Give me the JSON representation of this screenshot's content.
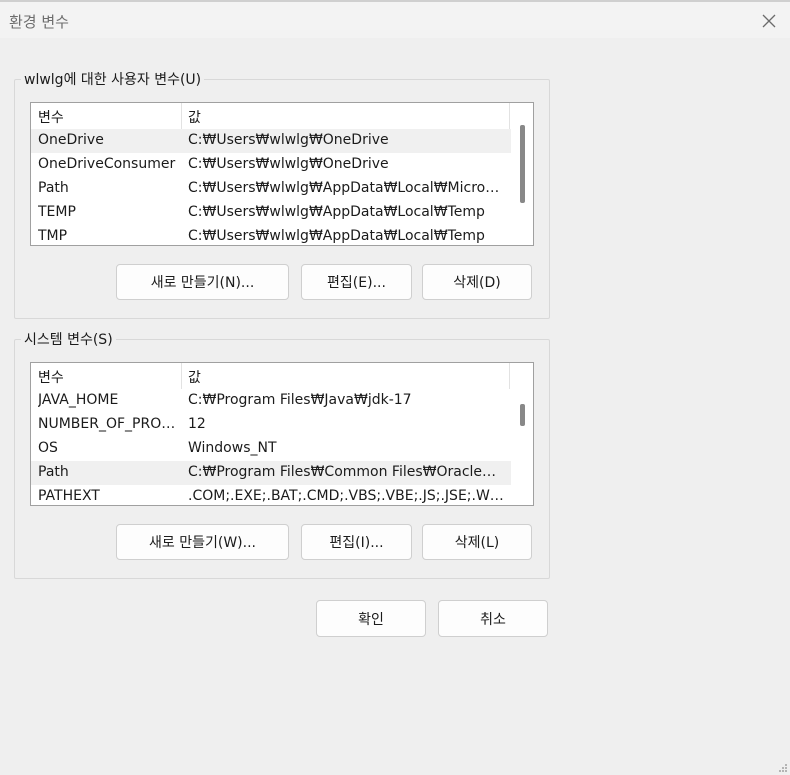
{
  "window": {
    "title": "환경 변수"
  },
  "user_vars": {
    "group_label": "wlwlg에 대한 사용자 변수(U)",
    "columns": [
      "변수",
      "값"
    ],
    "rows": [
      {
        "name": "OneDrive",
        "value": "C:₩Users₩wlwlg₩OneDrive"
      },
      {
        "name": "OneDriveConsumer",
        "value": "C:₩Users₩wlwlg₩OneDrive"
      },
      {
        "name": "Path",
        "value": "C:₩Users₩wlwlg₩AppData₩Local₩Microsoft₩WindowsApps"
      },
      {
        "name": "TEMP",
        "value": "C:₩Users₩wlwlg₩AppData₩Local₩Temp"
      },
      {
        "name": "TMP",
        "value": "C:₩Users₩wlwlg₩AppData₩Local₩Temp"
      }
    ],
    "buttons": {
      "new": "새로 만들기(N)...",
      "edit": "편집(E)...",
      "delete": "삭제(D)"
    }
  },
  "system_vars": {
    "group_label": "시스템 변수(S)",
    "columns": [
      "변수",
      "값"
    ],
    "rows": [
      {
        "name": "JAVA_HOME",
        "value": "C:₩Program Files₩Java₩jdk-17"
      },
      {
        "name": "NUMBER_OF_PROCESSORS",
        "value": "12"
      },
      {
        "name": "OS",
        "value": "Windows_NT"
      },
      {
        "name": "Path",
        "value": "C:₩Program Files₩Common Files₩Oracle₩Java₩javapath"
      },
      {
        "name": "PATHEXT",
        "value": ".COM;.EXE;.BAT;.CMD;.VBS;.VBE;.JS;.JSE;.WSF;.WSH;.MSC"
      }
    ],
    "buttons": {
      "new": "새로 만들기(W)...",
      "edit": "편집(I)...",
      "delete": "삭제(L)"
    }
  },
  "dialog_buttons": {
    "ok": "확인",
    "cancel": "취소"
  },
  "icons": {
    "close": "close-icon",
    "resize": "resize-grip-icon"
  }
}
